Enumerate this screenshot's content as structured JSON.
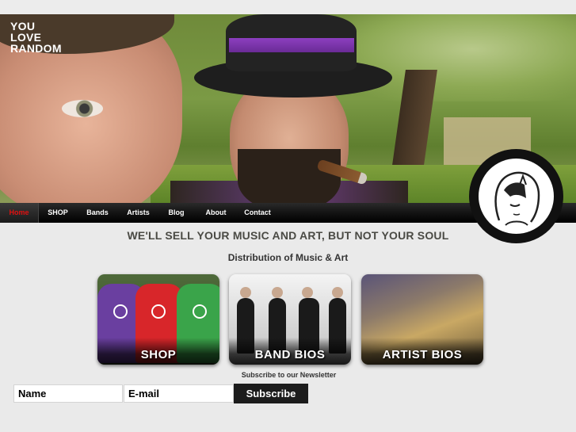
{
  "brand": {
    "logo_lines": [
      "YOU",
      "LOVE",
      "RANDOM"
    ]
  },
  "nav": {
    "items": [
      {
        "label": "Home",
        "active": true
      },
      {
        "label": "SHOP",
        "active": false
      },
      {
        "label": "Bands",
        "active": false
      },
      {
        "label": "Artists",
        "active": false
      },
      {
        "label": "Blog",
        "active": false
      },
      {
        "label": "About",
        "active": false
      },
      {
        "label": "Contact",
        "active": false
      }
    ]
  },
  "main": {
    "headline": "WE'LL SELL YOUR MUSIC AND ART, BUT NOT YOUR SOUL",
    "subheadline": "Distribution of Music & Art",
    "tiles": [
      {
        "label": "SHOP"
      },
      {
        "label": "BAND BIOS"
      },
      {
        "label": "ARTIST BIOS"
      }
    ]
  },
  "newsletter": {
    "title": "Subscribe to our Newsletter",
    "name_placeholder": "Name",
    "email_placeholder": "E-mail",
    "button_label": "Subscribe"
  },
  "colors": {
    "nav_background": "#111111",
    "nav_active": "#e01010",
    "page_background": "#eaeaea",
    "headline_text": "#4a4a44",
    "subscribe_button": "#1c1c1c"
  }
}
